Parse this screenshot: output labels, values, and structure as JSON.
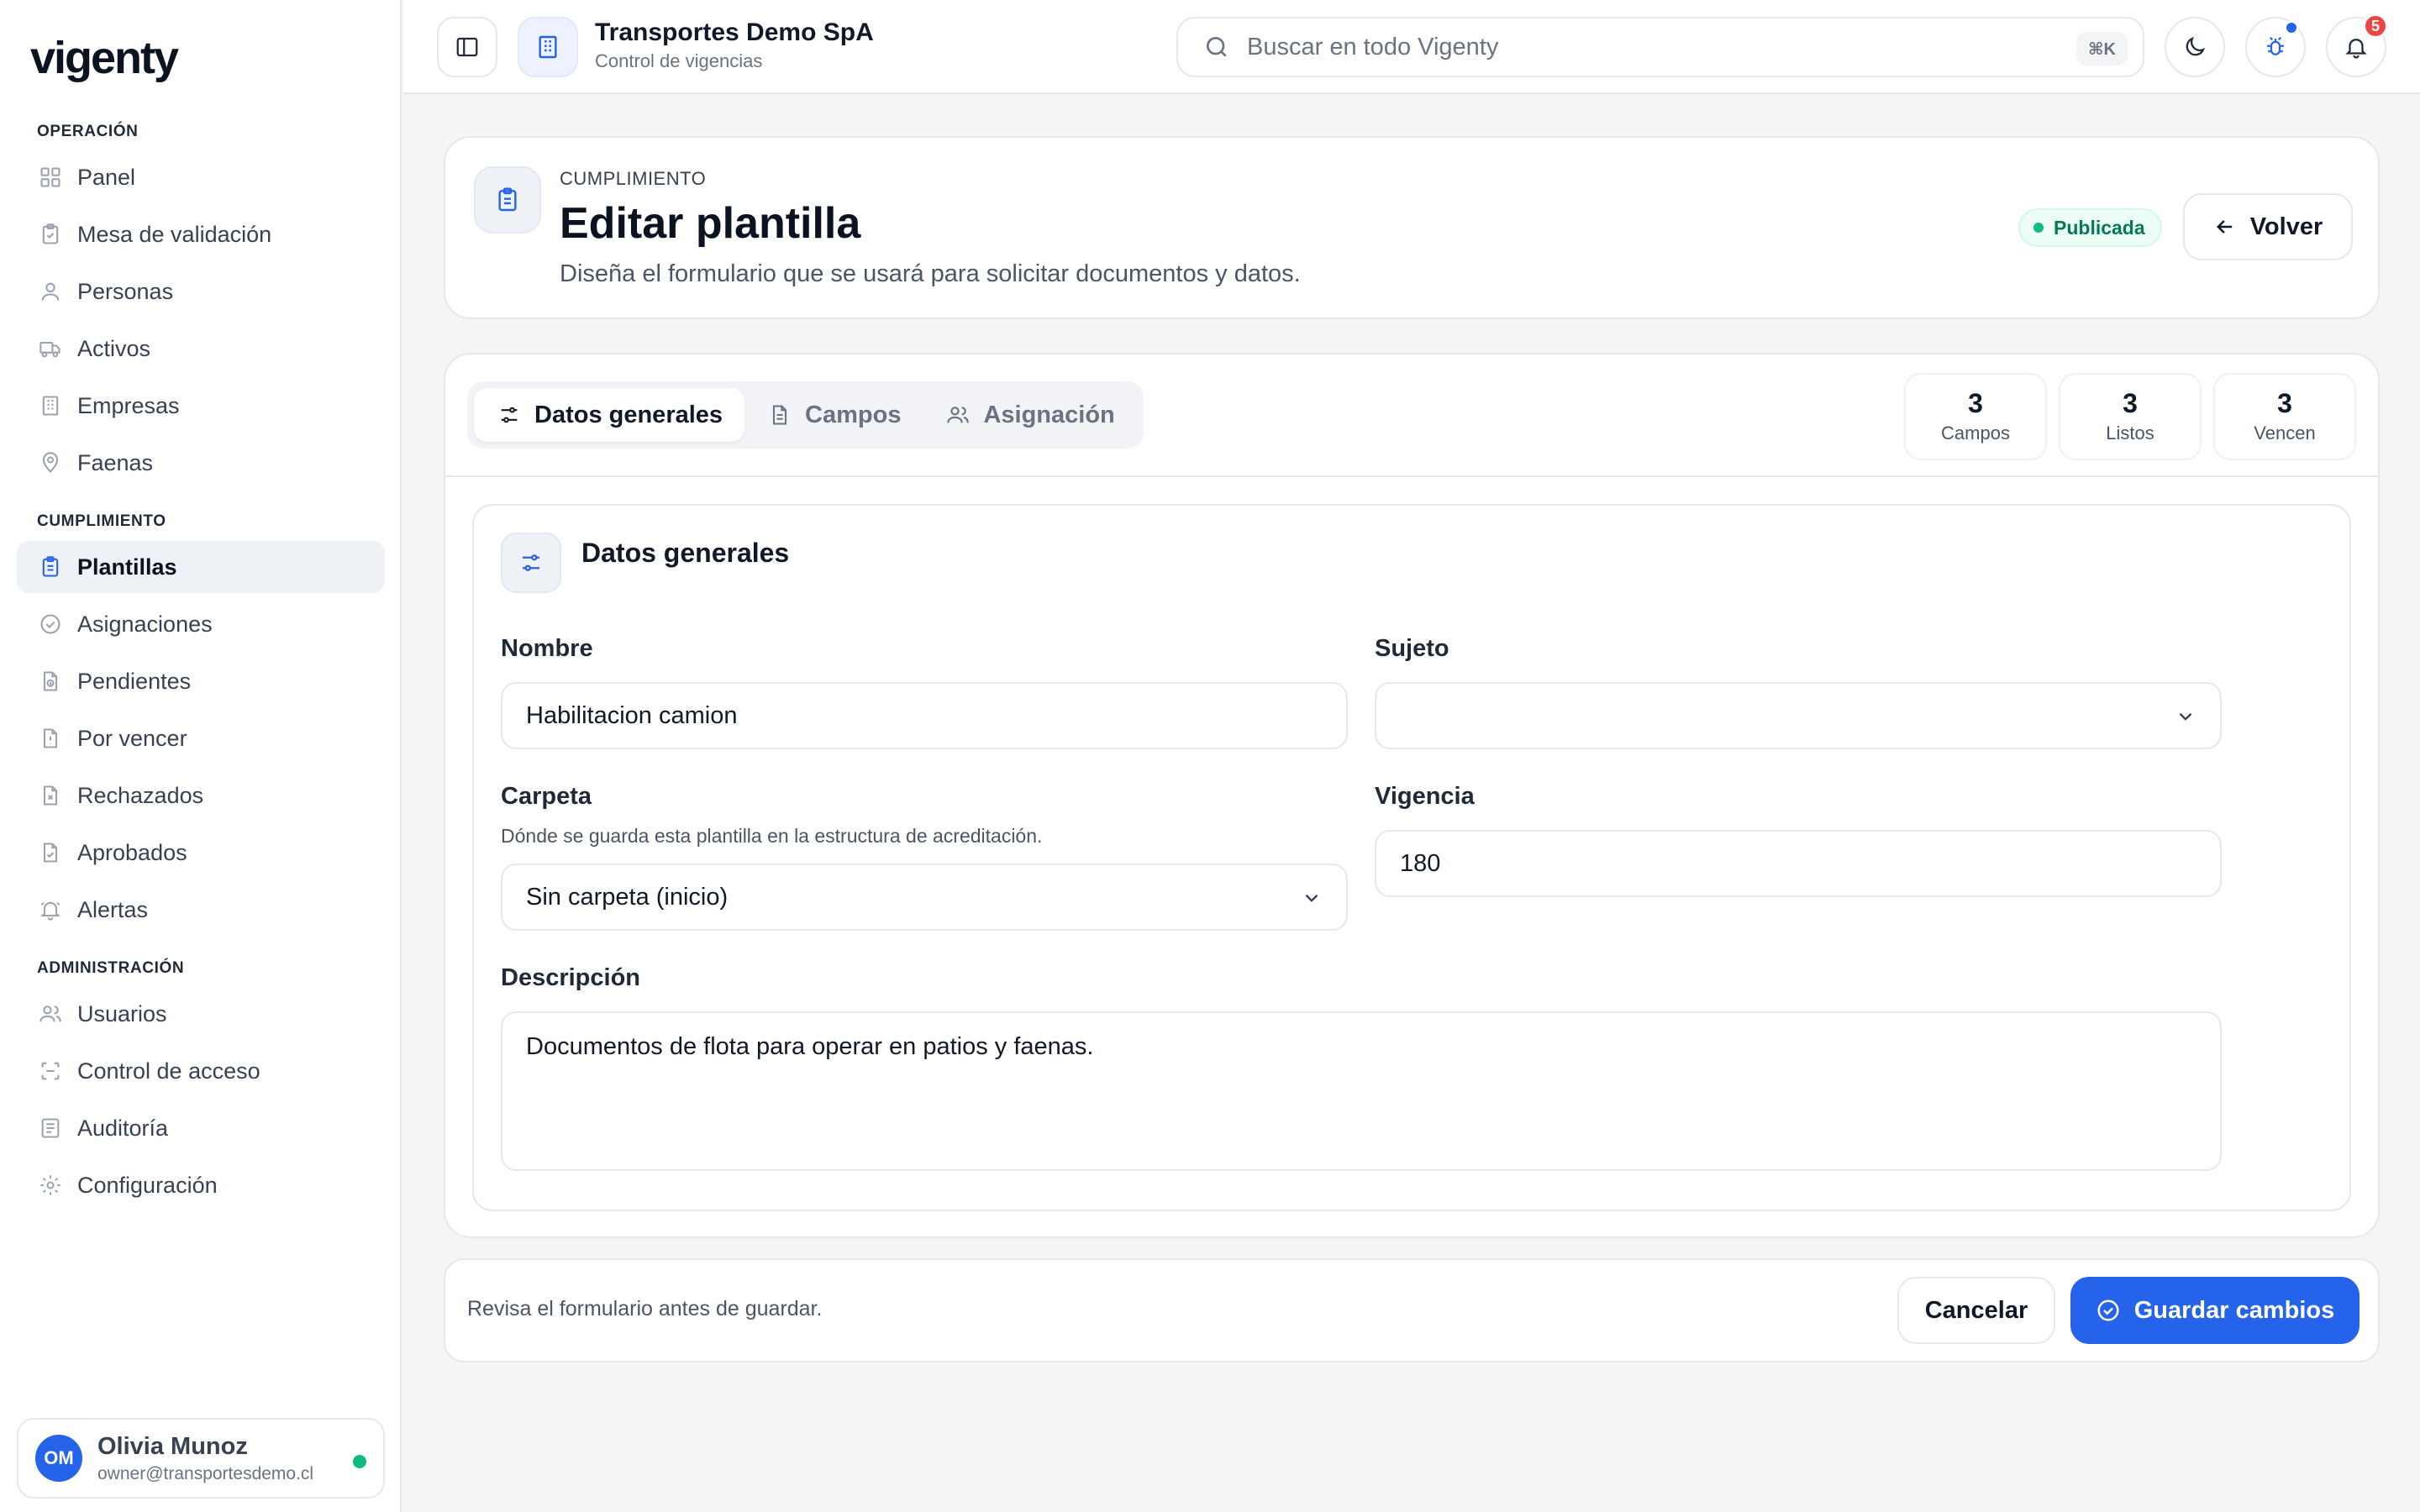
{
  "brand": {
    "logo_text": "vigenty",
    "accent": "#2563eb"
  },
  "sidebar": {
    "sections": [
      {
        "label": "OPERACIÓN"
      },
      {
        "label": "CUMPLIMIENTO"
      },
      {
        "label": "ADMINISTRACIÓN"
      }
    ],
    "items": [
      {
        "label": "Panel",
        "icon": "grid-icon"
      },
      {
        "label": "Mesa de validación",
        "icon": "clipboard-check-icon"
      },
      {
        "label": "Personas",
        "icon": "user-icon"
      },
      {
        "label": "Activos",
        "icon": "truck-icon"
      },
      {
        "label": "Empresas",
        "icon": "building-icon"
      },
      {
        "label": "Faenas",
        "icon": "map-pin-icon"
      },
      {
        "label": "Plantillas",
        "icon": "clipboard-list-icon",
        "active": true
      },
      {
        "label": "Asignaciones",
        "icon": "check-circle-icon"
      },
      {
        "label": "Pendientes",
        "icon": "file-clock-icon"
      },
      {
        "label": "Por vencer",
        "icon": "file-alert-icon"
      },
      {
        "label": "Rechazados",
        "icon": "file-x-icon"
      },
      {
        "label": "Aprobados",
        "icon": "file-check-icon"
      },
      {
        "label": "Alertas",
        "icon": "bell-ring-icon"
      },
      {
        "label": "Usuarios",
        "icon": "users-icon"
      },
      {
        "label": "Control de acceso",
        "icon": "scan-icon"
      },
      {
        "label": "Auditoría",
        "icon": "list-icon"
      },
      {
        "label": "Configuración",
        "icon": "gear-icon"
      }
    ],
    "user": {
      "initials": "OM",
      "name": "Olivia Munoz",
      "email": "owner@transportesdemo.cl",
      "status_color": "#10b981"
    }
  },
  "topbar": {
    "org_name": "Transportes Demo SpA",
    "org_subtitle": "Control de vigencias",
    "search_placeholder": "Buscar en todo Vigenty",
    "search_shortcut": "⌘K",
    "notification_count": "5"
  },
  "header": {
    "eyebrow": "CUMPLIMIENTO",
    "title": "Editar plantilla",
    "description": "Diseña el formulario que se usará para solicitar documentos y datos.",
    "status": "Publicada",
    "back_label": "Volver"
  },
  "tabs": [
    {
      "label": "Datos generales",
      "icon": "sliders-icon",
      "active": true
    },
    {
      "label": "Campos",
      "icon": "file-text-icon"
    },
    {
      "label": "Asignación",
      "icon": "users-icon"
    }
  ],
  "stats": [
    {
      "value": "3",
      "label": "Campos"
    },
    {
      "value": "3",
      "label": "Listos"
    },
    {
      "value": "3",
      "label": "Vencen"
    }
  ],
  "form": {
    "section_title": "Datos generales",
    "nombre": {
      "label": "Nombre",
      "value": "Habilitacion camion"
    },
    "sujeto": {
      "label": "Sujeto",
      "value": ""
    },
    "carpeta": {
      "label": "Carpeta",
      "help": "Dónde se guarda esta plantilla en la estructura de acreditación.",
      "value": "Sin carpeta (inicio)"
    },
    "vigencia": {
      "label": "Vigencia",
      "value": "180"
    },
    "descripcion": {
      "label": "Descripción",
      "value": "Documentos de flota para operar en patios y faenas."
    }
  },
  "footer": {
    "hint": "Revisa el formulario antes de guardar.",
    "cancel_label": "Cancelar",
    "save_label": "Guardar cambios"
  }
}
